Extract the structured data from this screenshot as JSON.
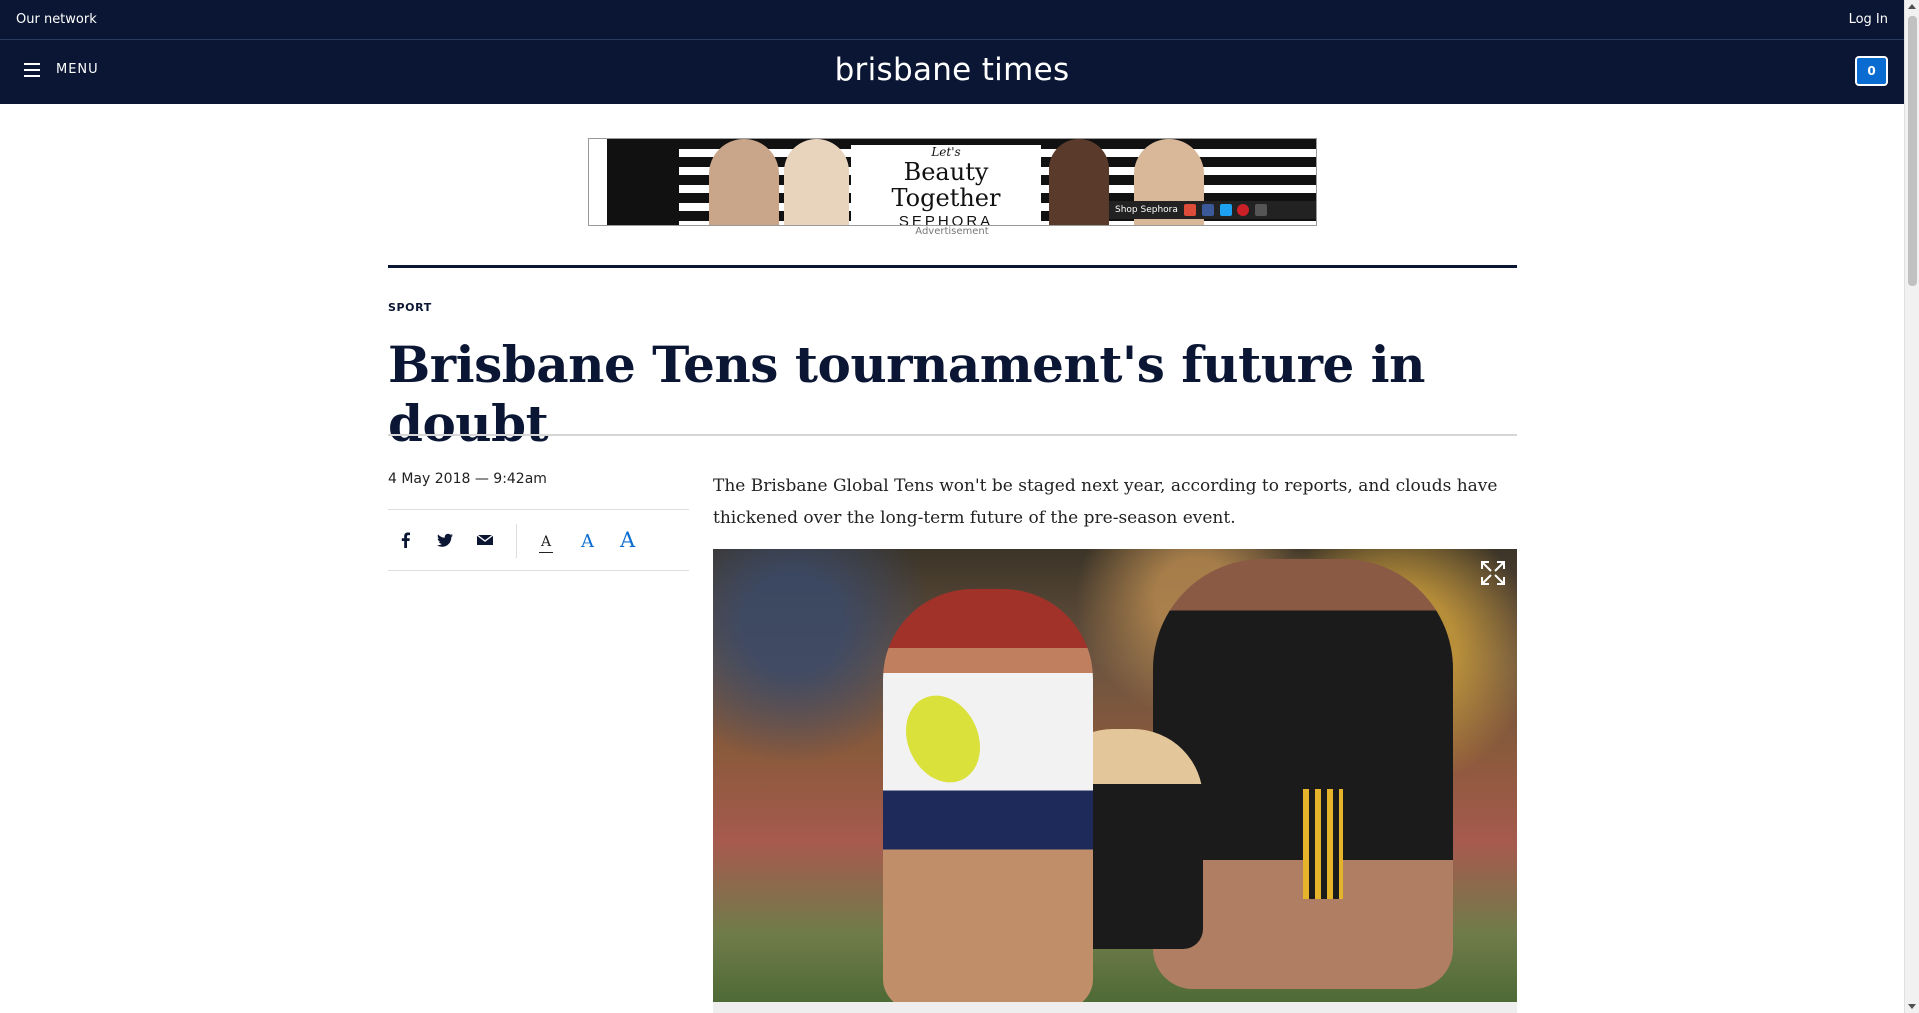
{
  "network_bar": {
    "network_label": "Our network",
    "login_label": "Log In"
  },
  "header": {
    "menu_label": "MENU",
    "logo_text": "brisbane times",
    "cart_count": "0"
  },
  "ad": {
    "tagline": "Let's",
    "headline": "Beauty Together",
    "brand": "SEPHORA",
    "cta": "Shop Sephora",
    "label": "Advertisement"
  },
  "article": {
    "section": "SPORT",
    "headline": "Brisbane Tens tournament's future in doubt",
    "dateline": "4 May 2018 — 9:42am",
    "lead": "The Brisbane Global Tens won't be staged next year, according to reports, and clouds have thickened over the long-term future of the pre-season event.",
    "font_sizes": [
      "A",
      "A",
      "A"
    ]
  },
  "share": {
    "icons": [
      "facebook-icon",
      "twitter-icon",
      "email-icon"
    ]
  },
  "colors": {
    "navy": "#0a1633",
    "accent_blue": "#0a6cd1"
  }
}
